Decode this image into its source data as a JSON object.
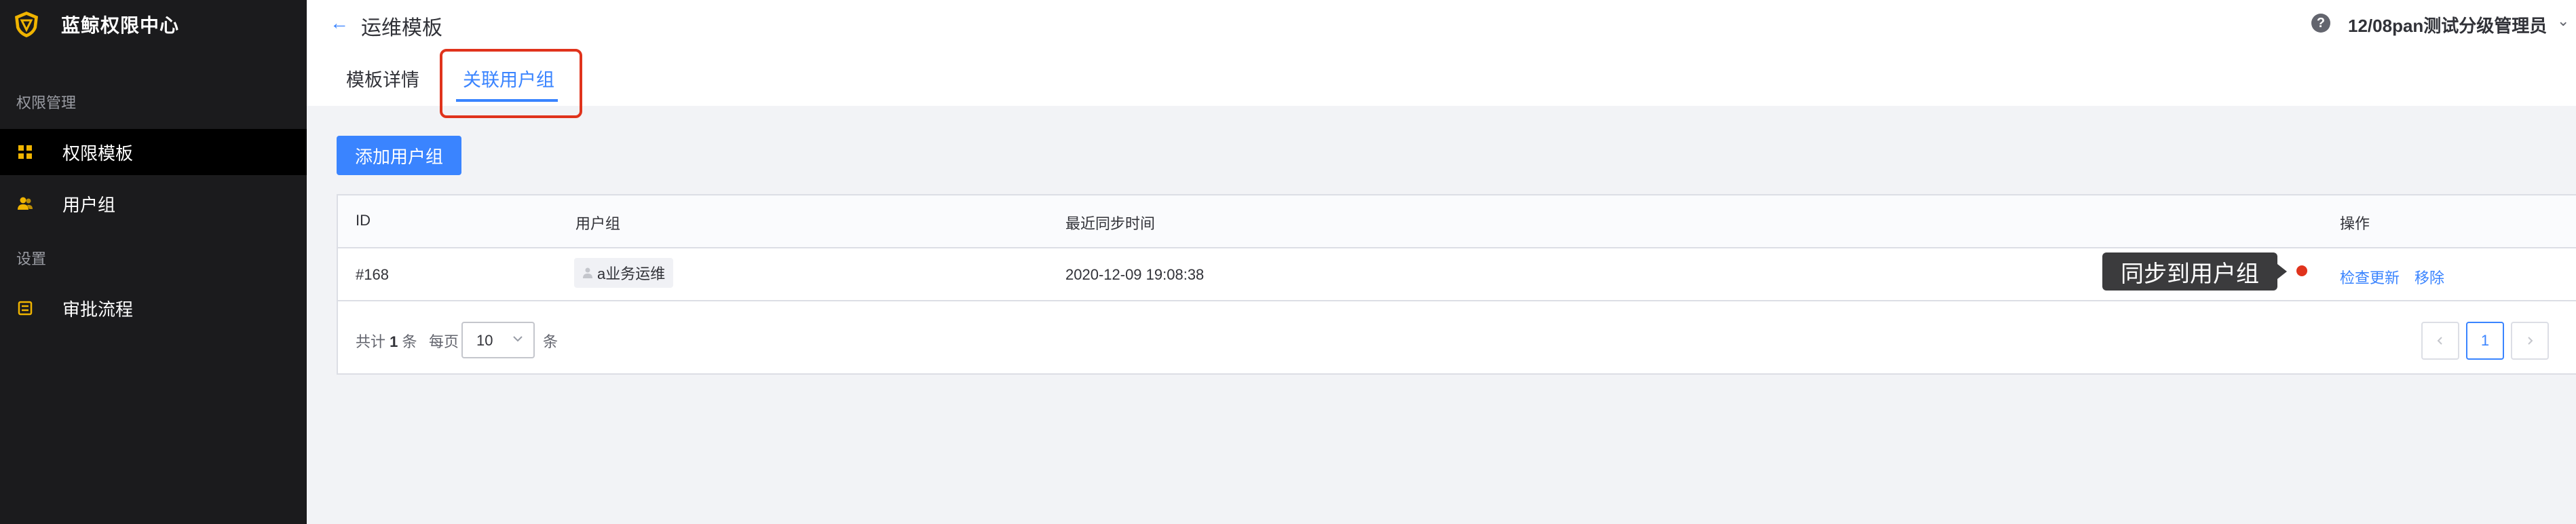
{
  "sidebar": {
    "app_title": "蓝鲸权限中心",
    "sections": [
      {
        "label": "权限管理",
        "items": [
          {
            "label": "权限模板",
            "icon": "template-grid-icon",
            "active": true
          },
          {
            "label": "用户组",
            "icon": "user-group-icon",
            "active": false
          }
        ]
      },
      {
        "label": "设置",
        "items": [
          {
            "label": "审批流程",
            "icon": "approval-flow-icon",
            "active": false
          }
        ]
      }
    ]
  },
  "header": {
    "back_icon": "←",
    "title": "运维模板",
    "help_icon": "?",
    "user_name": "12/08pan测试分级管理员",
    "user_chevron": "⌄",
    "tabs": [
      {
        "label": "模板详情",
        "active": false
      },
      {
        "label": "关联用户组",
        "active": true
      }
    ]
  },
  "main": {
    "add_button_label": "添加用户组",
    "table": {
      "columns": [
        "ID",
        "用户组",
        "最近同步时间",
        "操作"
      ],
      "rows": [
        {
          "id": "#168",
          "group": "a业务运维",
          "last_sync": "2020-12-09 19:08:38",
          "actions": [
            "检查更新",
            "移除"
          ],
          "tooltip": "同步到用户组"
        }
      ]
    },
    "pagination": {
      "total_prefix": "共计",
      "total": "1",
      "total_suffix": "条",
      "per_page_label": "每页",
      "page_size": "10",
      "per_page_suffix": "条",
      "current_page": "1"
    }
  },
  "colors": {
    "sidebar_bg": "#1b1b1d",
    "accent": "#3a84ff",
    "highlight": "#e0331c",
    "logo_gold": "#f0b400"
  }
}
